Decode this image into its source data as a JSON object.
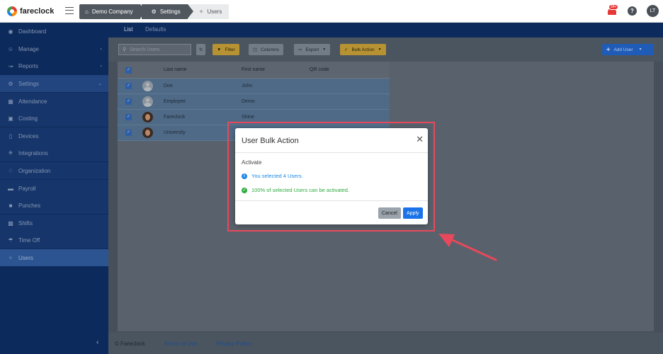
{
  "app": {
    "name": "fareclock"
  },
  "breadcrumb": [
    {
      "label": "Demo Company",
      "icon": "home-icon"
    },
    {
      "label": "Settings",
      "icon": "gear-icon"
    },
    {
      "label": "Users",
      "icon": "users-icon"
    }
  ],
  "header": {
    "notification_count": "34+",
    "help": "?",
    "user_initials": "LT"
  },
  "sidebar": {
    "items": [
      {
        "label": "Dashboard",
        "icon": "dashboard-icon"
      },
      {
        "label": "Manage",
        "icon": "person-icon",
        "chevron": "‹"
      },
      {
        "label": "Reports",
        "icon": "chart-icon",
        "chevron": "‹"
      },
      {
        "label": "Settings",
        "icon": "gear-icon",
        "chevron": "⌄"
      },
      {
        "label": "Attendance",
        "icon": "attendance-icon"
      },
      {
        "label": "Costing",
        "icon": "folder-icon"
      },
      {
        "label": "Devices",
        "icon": "device-icon"
      },
      {
        "label": "Integrations",
        "icon": "plug-icon"
      },
      {
        "label": "Organization",
        "icon": "org-icon"
      },
      {
        "label": "Payroll",
        "icon": "money-icon"
      },
      {
        "label": "Punches",
        "icon": "punch-icon"
      },
      {
        "label": "Shifts",
        "icon": "calendar-icon"
      },
      {
        "label": "Time Off",
        "icon": "umbrella-icon"
      },
      {
        "label": "Users",
        "icon": "users-icon"
      }
    ],
    "collapse": "‹"
  },
  "subnav": {
    "tabs": [
      "List",
      "Defaults"
    ]
  },
  "toolbar": {
    "search_placeholder": "Search Users",
    "refresh": "↻",
    "filter": "Filter",
    "columns": "Columns",
    "export": "Export",
    "bulk_action": "Bulk Action",
    "add_user": "Add User"
  },
  "table": {
    "columns": [
      "Last name",
      "First name",
      "QR code"
    ],
    "rows": [
      {
        "last": "Doe",
        "first": "John",
        "avatar": "generic"
      },
      {
        "last": "Employee",
        "first": "Demo",
        "avatar": "generic"
      },
      {
        "last": "Fareclock",
        "first": "Shine",
        "avatar": "photo"
      },
      {
        "last": "University",
        "first": "",
        "avatar": "photo"
      }
    ]
  },
  "footer": {
    "copyright": "© Fareclock",
    "terms": "Terms of Use",
    "privacy": "Privacy Policy"
  },
  "modal": {
    "title": "User Bulk Action",
    "close": "✕",
    "action": "Activate",
    "info": "You selected 4 Users.",
    "success": "100% of selected Users can be activated.",
    "cancel": "Cancel",
    "apply": "Apply"
  },
  "colors": {
    "sidebar": "#0d2a5c",
    "primary": "#1a73e8",
    "success": "#2eaa3e",
    "warning": "#f4b400",
    "annotation": "#e8485b"
  }
}
